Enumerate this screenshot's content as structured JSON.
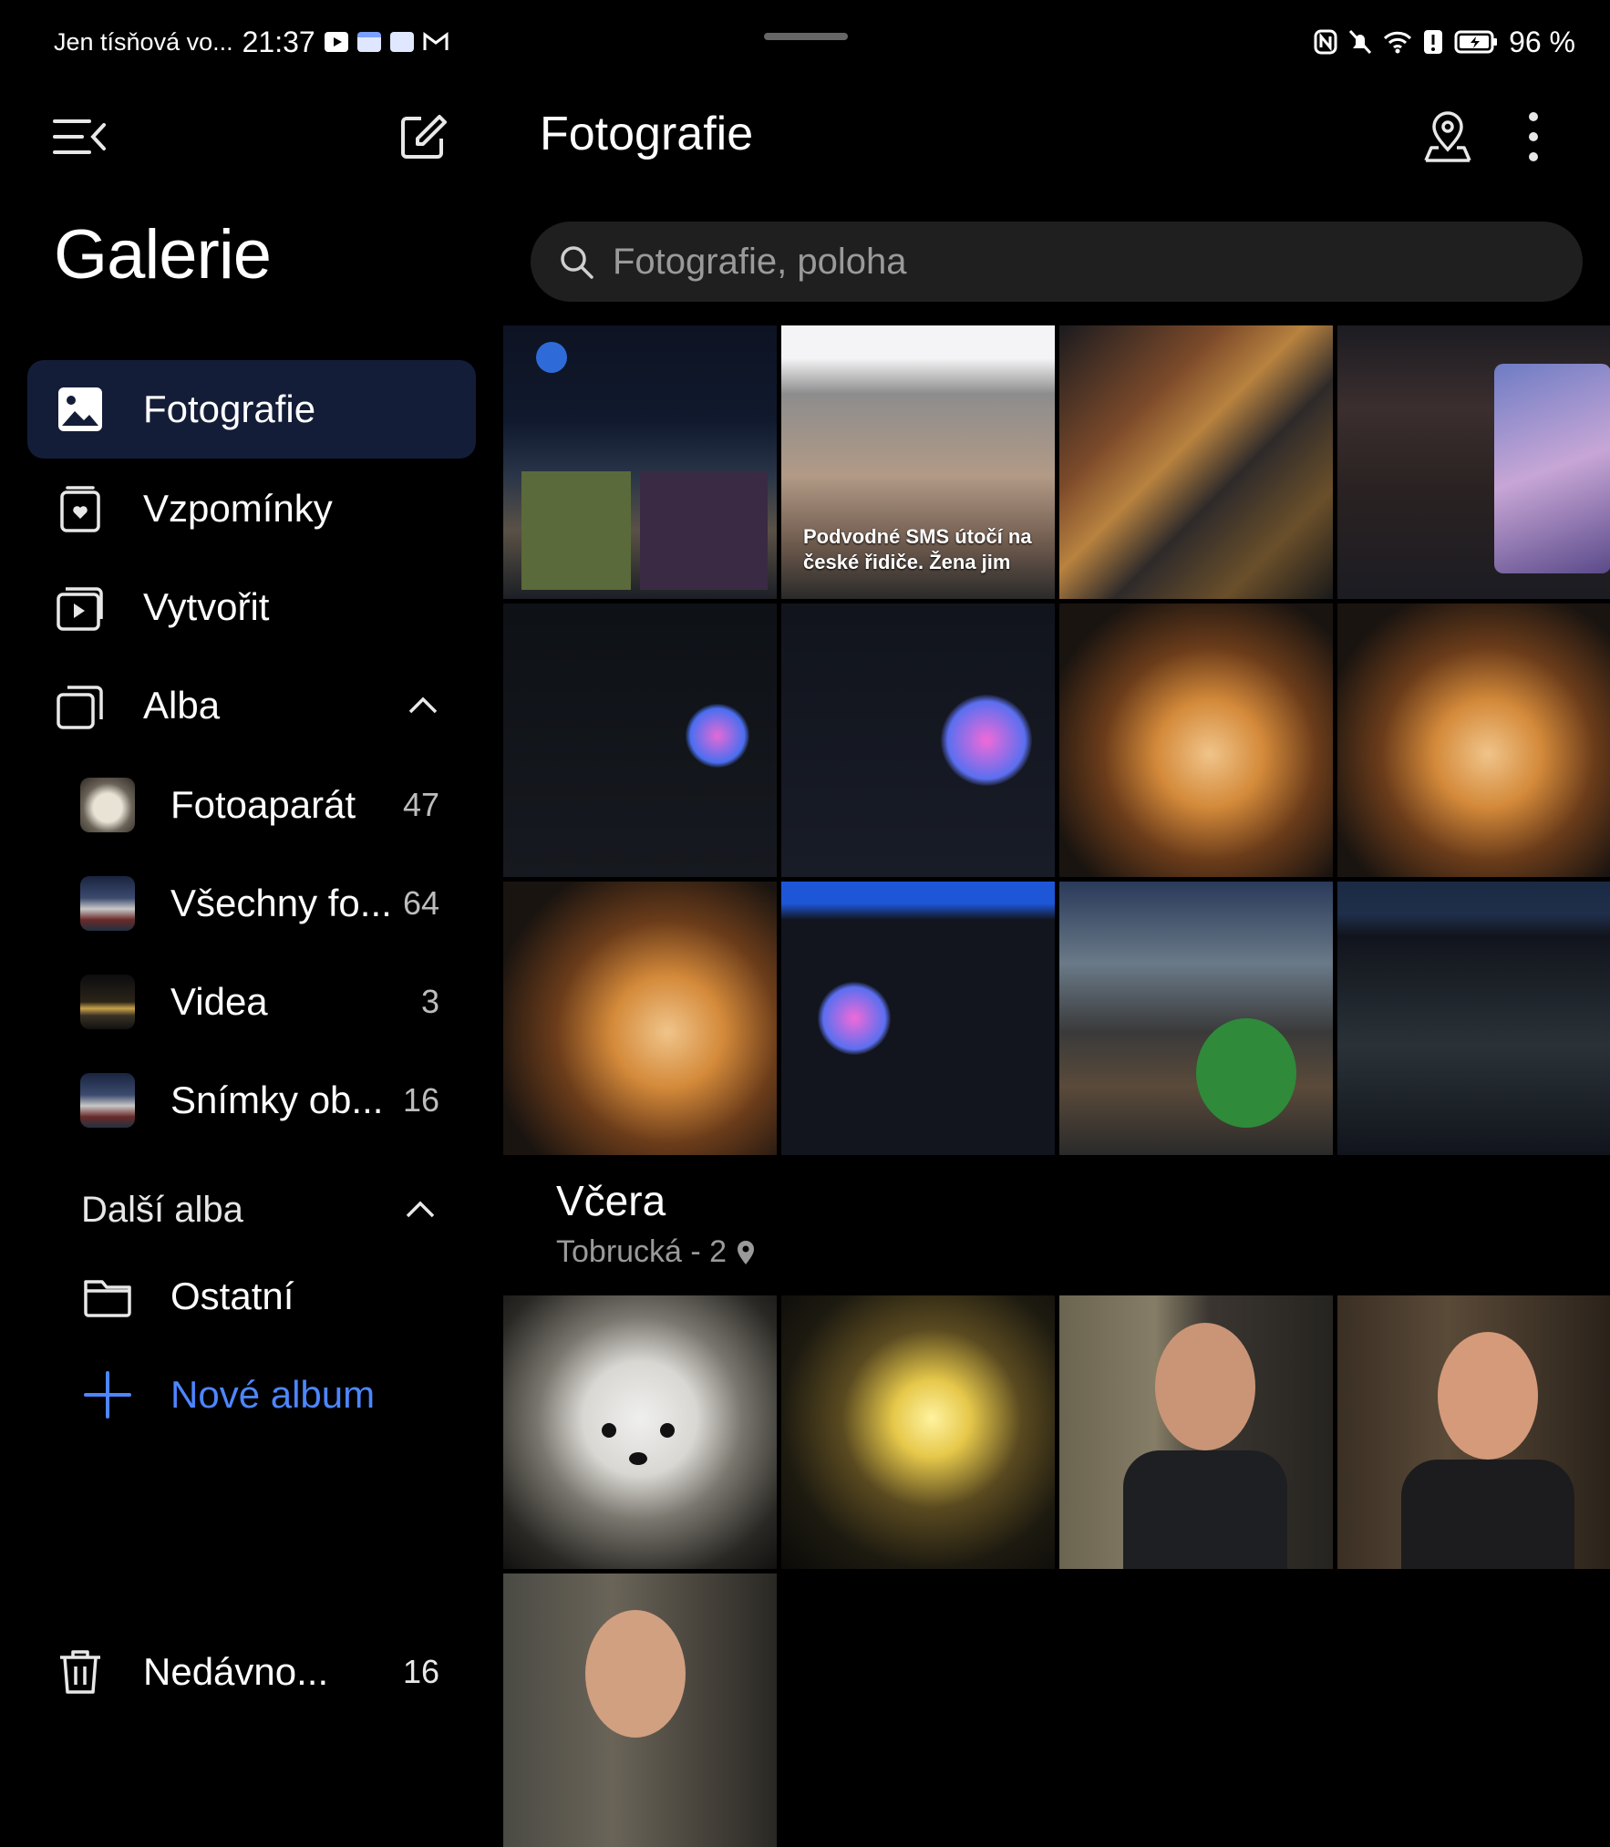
{
  "status_bar": {
    "carrier": "Jen tísňová vo...",
    "time": "21:37",
    "battery": "96 %"
  },
  "sidebar": {
    "app_title": "Galerie",
    "nav": [
      {
        "label": "Fotografie",
        "icon": "photo-icon",
        "active": true
      },
      {
        "label": "Vzpomínky",
        "icon": "memories-icon"
      },
      {
        "label": "Vytvořit",
        "icon": "create-icon"
      },
      {
        "label": "Alba",
        "icon": "albums-icon"
      }
    ],
    "albums": [
      {
        "name": "Fotoaparát",
        "count": "47"
      },
      {
        "name": "Všechny fo...",
        "count": "64"
      },
      {
        "name": "Videa",
        "count": "3"
      },
      {
        "name": "Snímky ob...",
        "count": "16"
      }
    ],
    "more_albums_title": "Další alba",
    "more_albums": [
      {
        "name": "Ostatní",
        "icon": "folder-icon"
      }
    ],
    "new_album_label": "Nové album",
    "trash": {
      "label": "Nedávno...",
      "count": "16"
    }
  },
  "main": {
    "title": "Fotografie",
    "search_placeholder": "Fotografie, poloha",
    "top_grid_captions": {
      "tile_2": "Podvodné SMS útočí na české řidiče. Žena jim"
    },
    "date_section": {
      "title": "Včera",
      "location": "Tobrucká - 2"
    }
  },
  "colors": {
    "background": "#000000",
    "active_nav": "#141d38",
    "accent": "#4d86ff",
    "search_bg": "#1f1f1f"
  }
}
